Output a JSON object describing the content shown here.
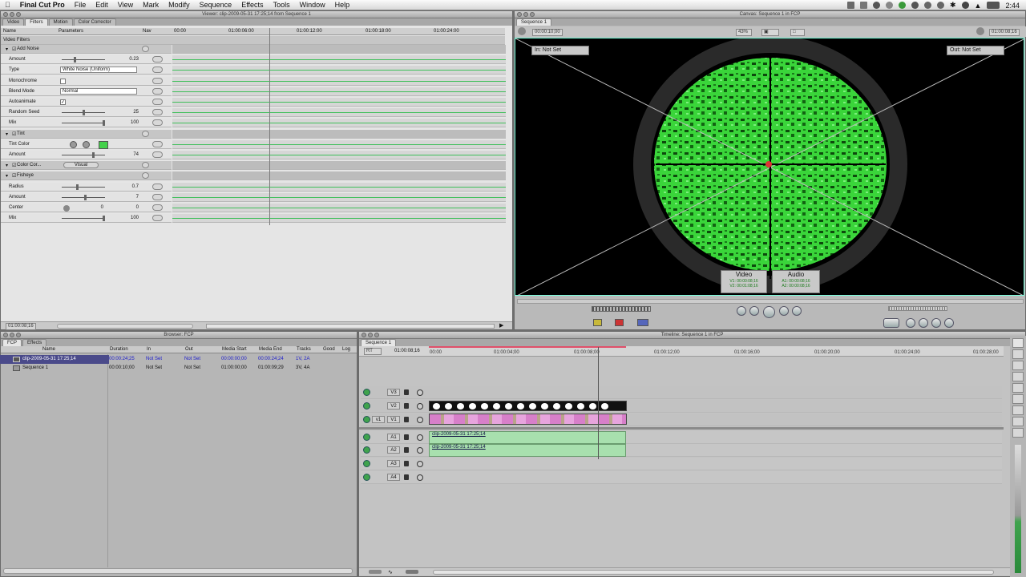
{
  "menubar": {
    "apple": "",
    "app": "Final Cut Pro",
    "items": [
      "File",
      "Edit",
      "View",
      "Mark",
      "Modify",
      "Sequence",
      "Effects",
      "Tools",
      "Window",
      "Help"
    ],
    "clock": "2:44"
  },
  "viewer": {
    "title": "Viewer: clip-2009-05-31 17:25;14 from Sequence 1",
    "tabs": [
      "Video",
      "Filters",
      "Motion",
      "Color Corrector"
    ],
    "columns": [
      "Name",
      "Parameters",
      "Nav"
    ],
    "ruler": [
      "00:00",
      "01:00:06:00",
      "01:00:12:00",
      "01:00:18:00",
      "01:00:24:00"
    ],
    "section": "Video Filters",
    "rows": [
      {
        "name": "Add Noise",
        "type": "header"
      },
      {
        "name": "Amount",
        "value": "0.23",
        "slider": 0.3
      },
      {
        "name": "Type",
        "select": "White Noise (Uniform)"
      },
      {
        "name": "Monochrome",
        "check": false
      },
      {
        "name": "Blend Mode",
        "select": "Normal"
      },
      {
        "name": "Autoanimate",
        "check": true
      },
      {
        "name": "Random Seed",
        "value": "25",
        "slider": 0.5
      },
      {
        "name": "Mix",
        "value": "100",
        "slider": 1.0
      },
      {
        "name": "Tint",
        "type": "header"
      },
      {
        "name": "Tint Color",
        "color": "#43d14a"
      },
      {
        "name": "Amount",
        "value": "74",
        "slider": 0.74
      },
      {
        "name": "Color Cor...",
        "type": "header",
        "button": "Visual"
      },
      {
        "name": "Fisheye",
        "type": "header"
      },
      {
        "name": "Radius",
        "value": "0.7",
        "slider": 0.35
      },
      {
        "name": "Amount",
        "value": "7",
        "slider": 0.55
      },
      {
        "name": "Center",
        "value": "0",
        "value2": "0"
      },
      {
        "name": "Mix",
        "value": "100",
        "slider": 1.0
      }
    ],
    "timecode": "01:00:08;16"
  },
  "canvas": {
    "title": "Canvas: Sequence 1 in FCP",
    "tab": "Sequence 1",
    "duration": "00:00:10;00",
    "zoom": "43%",
    "timecode": "01:00:08;16",
    "in": "In:  Not Set",
    "out": "Out:  Not Set",
    "video_label": "Video",
    "audio_label": "Audio",
    "v1": "V1: 00:00:08;16",
    "v2": "V2: 00:01:08;16",
    "a1": "A1: 00:00:08;16",
    "a2": "A2: 00:00:08;16",
    "tint_color": "#3ee53a"
  },
  "browser": {
    "title": "Browser: FCP",
    "tabs": [
      "FCP",
      "Effects"
    ],
    "columns": [
      "Name",
      "Duration",
      "In",
      "Out",
      "Media Start",
      "Media End",
      "Tracks",
      "Good",
      "Log"
    ],
    "rows": [
      {
        "name": "clip-2009-05-31 17:25;14",
        "duration": "00:00:24;25",
        "in": "Not Set",
        "out": "Not Set",
        "mstart": "00:00:00;00",
        "mend": "00:00:24;24",
        "tracks": "1V, 2A"
      },
      {
        "name": "Sequence 1",
        "duration": "00:00:10;00",
        "in": "Not Set",
        "out": "Not Set",
        "mstart": "01:00:00;00",
        "mend": "01:00:09;29",
        "tracks": "3V, 4A"
      }
    ]
  },
  "timeline": {
    "title": "Timeline: Sequence 1 in FCP",
    "tab": "Sequence 1",
    "rt": "RT",
    "timecode": "01:00:08;16",
    "ruler": [
      "00:00",
      "01:00:04;00",
      "01:00:08;00",
      "01:00:12;00",
      "01:00:16;00",
      "01:00:20;00",
      "01:00:24;00",
      "01:00:28;00"
    ],
    "video_tracks": [
      "V3",
      "V2",
      "V1"
    ],
    "audio_tracks": [
      "A1",
      "A2",
      "A3",
      "A4"
    ],
    "v1_src": "v1",
    "clip_name": "clip-2009-05-31 17:25;14"
  }
}
